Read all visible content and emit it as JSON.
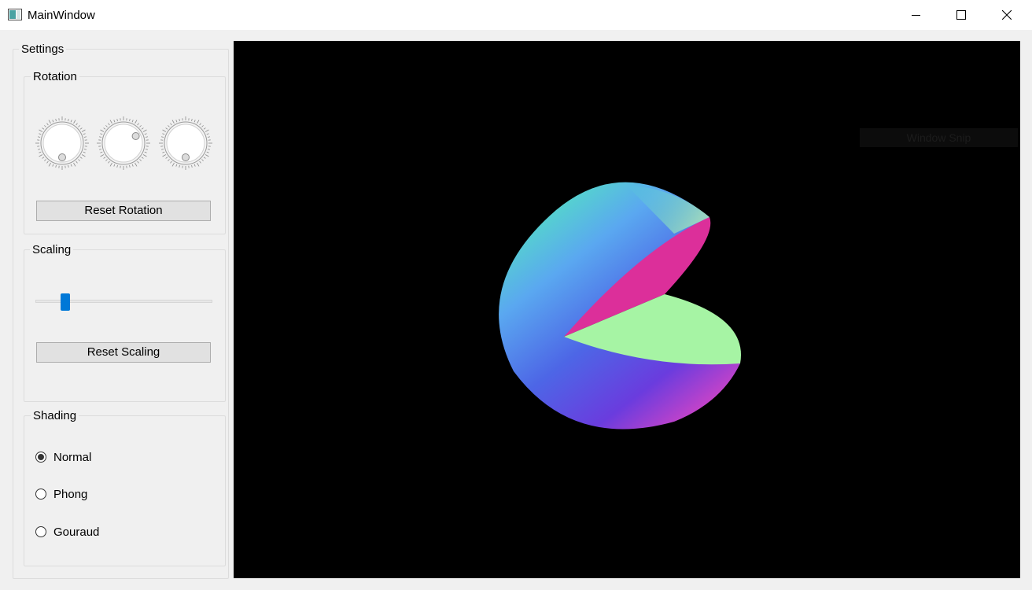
{
  "window": {
    "title": "MainWindow"
  },
  "settings": {
    "title": "Settings",
    "rotation": {
      "title": "Rotation",
      "dials": [
        {
          "name": "x",
          "angle_deg": 180
        },
        {
          "name": "y",
          "angle_deg": 60
        },
        {
          "name": "z",
          "angle_deg": 180
        }
      ],
      "reset_label": "Reset Rotation"
    },
    "scaling": {
      "title": "Scaling",
      "slider_value": 0.15,
      "reset_label": "Reset Scaling"
    },
    "shading": {
      "title": "Shading",
      "options": [
        {
          "label": "Normal",
          "checked": true
        },
        {
          "label": "Phong",
          "checked": false
        },
        {
          "label": "Gouraud",
          "checked": false
        }
      ]
    }
  },
  "viewport": {
    "background": "#000000",
    "overlay_text": "Window Snip"
  },
  "colors": {
    "accent": "#0078d7",
    "window_bg": "#f0f0f0"
  }
}
